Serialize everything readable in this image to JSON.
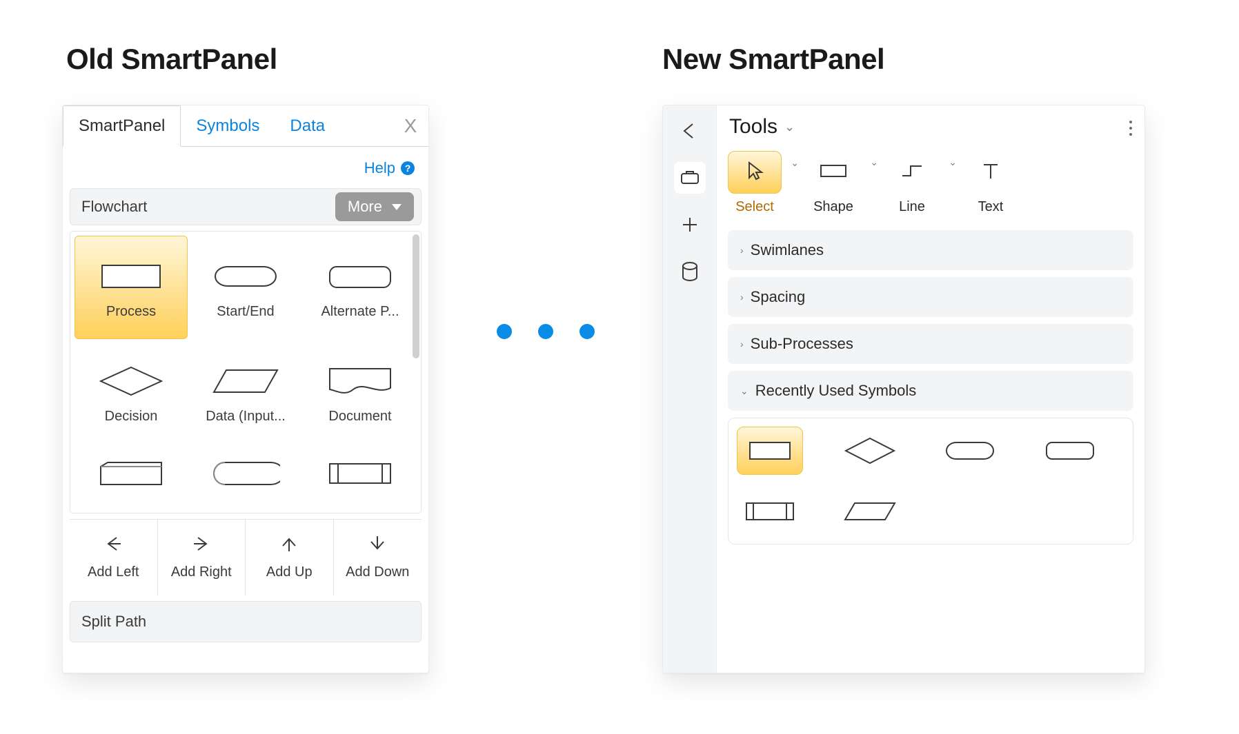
{
  "titles": {
    "old": "Old SmartPanel",
    "new": "New SmartPanel"
  },
  "transition": {
    "dots": 3,
    "color": "#0a8be5"
  },
  "old": {
    "tabs": [
      {
        "label": "SmartPanel",
        "active": true
      },
      {
        "label": "Symbols",
        "active": false
      },
      {
        "label": "Data",
        "active": false
      }
    ],
    "close_label": "X",
    "help_label": "Help",
    "help_icon": "question-circle-icon",
    "group": {
      "label": "Flowchart",
      "moreLabel": "More"
    },
    "shapes": [
      {
        "name": "Process",
        "selected": true,
        "icon": "rect-icon"
      },
      {
        "name": "Start/End",
        "selected": false,
        "icon": "stadium-icon"
      },
      {
        "name": "Alternate P...",
        "selected": false,
        "icon": "round-rect-icon"
      },
      {
        "name": "Decision",
        "selected": false,
        "icon": "diamond-icon"
      },
      {
        "name": "Data (Input...",
        "selected": false,
        "icon": "parallelogram-icon"
      },
      {
        "name": "Document",
        "selected": false,
        "icon": "document-icon"
      },
      {
        "name": "",
        "selected": false,
        "icon": "card-icon"
      },
      {
        "name": "",
        "selected": false,
        "icon": "display-icon"
      },
      {
        "name": "",
        "selected": false,
        "icon": "predefined-icon"
      }
    ],
    "add": [
      {
        "label": "Add Left",
        "dir": "left"
      },
      {
        "label": "Add Right",
        "dir": "right"
      },
      {
        "label": "Add Up",
        "dir": "up"
      },
      {
        "label": "Add Down",
        "dir": "down"
      }
    ],
    "splitPath": "Split Path"
  },
  "new": {
    "rail": [
      {
        "name": "back-icon"
      },
      {
        "name": "toolbox-icon"
      },
      {
        "name": "plus-icon"
      },
      {
        "name": "db-icon"
      }
    ],
    "head": {
      "title": "Tools"
    },
    "tools": [
      {
        "label": "Select",
        "icon": "cursor-icon",
        "selected": true,
        "hasChevron": true
      },
      {
        "label": "Shape",
        "icon": "rect-icon",
        "selected": false,
        "hasChevron": true
      },
      {
        "label": "Line",
        "icon": "step-line-icon",
        "selected": false,
        "hasChevron": true
      },
      {
        "label": "Text",
        "icon": "text-icon",
        "selected": false,
        "hasChevron": false
      }
    ],
    "accordion": [
      {
        "label": "Swimlanes",
        "open": false
      },
      {
        "label": "Spacing",
        "open": false
      },
      {
        "label": "Sub-Processes",
        "open": false
      },
      {
        "label": "Recently Used Symbols",
        "open": true
      }
    ],
    "recent": [
      {
        "icon": "rect-icon",
        "selected": true
      },
      {
        "icon": "diamond-icon",
        "selected": false
      },
      {
        "icon": "stadium-icon",
        "selected": false
      },
      {
        "icon": "round-rect-icon",
        "selected": false
      },
      {
        "icon": "predefined-icon",
        "selected": false
      },
      {
        "icon": "parallelogram-icon",
        "selected": false
      }
    ]
  }
}
